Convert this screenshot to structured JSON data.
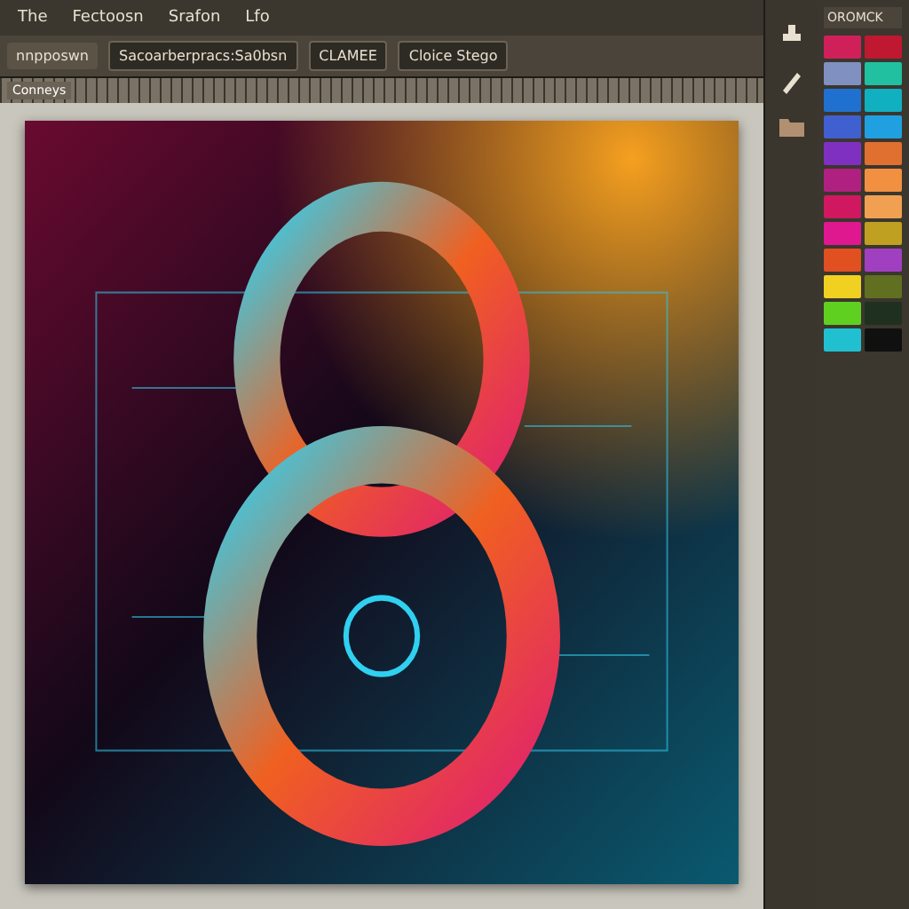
{
  "menu": [
    {
      "label": "The"
    },
    {
      "label": "Fectoosn"
    },
    {
      "label": "Srafon"
    },
    {
      "label": "Lfo"
    }
  ],
  "options_bar": {
    "preset": "Sacoarberpracs:Sa0bsn",
    "mode": "CLAMEE",
    "style": "Cloice Stego"
  },
  "document_tab": {
    "label": "nnpposwn"
  },
  "ruler_label": "Conneys",
  "panel": {
    "title": "OROMCK"
  },
  "swatches": [
    {
      "color": "#d0205a"
    },
    {
      "color": "#c01830"
    },
    {
      "color": "#8090c0"
    },
    {
      "color": "#20c0a0"
    },
    {
      "color": "#2070d0"
    },
    {
      "color": "#10b0c0"
    },
    {
      "color": "#4060d0"
    },
    {
      "color": "#20a0e0"
    },
    {
      "color": "#8030c0"
    },
    {
      "color": "#e07030"
    },
    {
      "color": "#b02080"
    },
    {
      "color": "#f09040"
    },
    {
      "color": "#d01860"
    },
    {
      "color": "#f0a050"
    },
    {
      "color": "#e01890"
    },
    {
      "color": "#c0a020"
    },
    {
      "color": "#e05020"
    },
    {
      "color": "#a040c0"
    },
    {
      "color": "#f0d020"
    },
    {
      "color": "#607020"
    },
    {
      "color": "#60d020"
    },
    {
      "color": "#203020"
    },
    {
      "color": "#20c0d0"
    },
    {
      "color": "#101010"
    }
  ]
}
